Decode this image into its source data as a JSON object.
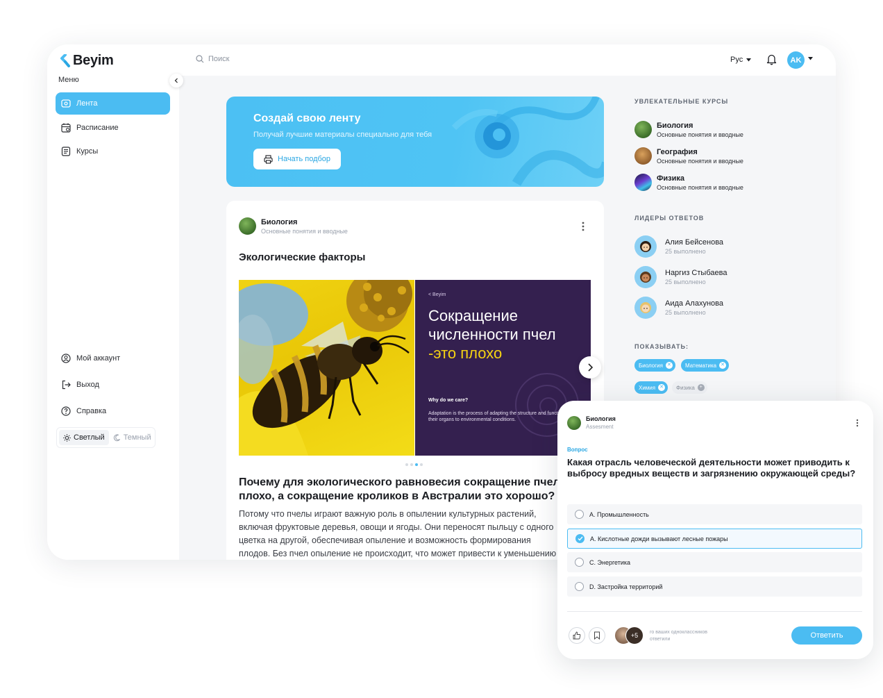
{
  "app": {
    "name": "Beyim"
  },
  "sidebar": {
    "menu_title": "Меню",
    "items": [
      {
        "label": "Лента",
        "icon": "feed-icon",
        "active": true
      },
      {
        "label": "Расписание",
        "icon": "calendar-icon"
      },
      {
        "label": "Курсы",
        "icon": "courses-icon"
      }
    ],
    "bottom_items": [
      {
        "label": "Мой аккаунт",
        "icon": "account-icon"
      },
      {
        "label": "Выход",
        "icon": "logout-icon"
      },
      {
        "label": "Справка",
        "icon": "help-icon"
      }
    ],
    "theme": {
      "light": "Светлый",
      "dark": "Темный",
      "selected": "light"
    }
  },
  "topbar": {
    "search_placeholder": "Поиск",
    "language": "Рус",
    "avatar_initials": "AK"
  },
  "hero": {
    "title": "Создай свою ленту",
    "subtitle": "Получай лучшие материалы специально для тебя",
    "button": "Начать подбор"
  },
  "post": {
    "course": "Биология",
    "course_sub": "Основные понятия и вводные",
    "title": "Экологические факторы",
    "slide": {
      "brand": "Beyim",
      "line1": "Сокращение",
      "line2": "численности пчел",
      "line3": "-это плохо",
      "question": "Why do we care?",
      "text": "Adaptation is the process of adapting the structure and functions of organisms and their organs to environmental conditions."
    },
    "dots_count": 4,
    "dots_active": 2,
    "question": "Почему для экологического равновесия сокращение пчел плохо, а сокращение кроликов в Австралии это хорошо?",
    "answer": "Потому что пчелы играют важную роль в опылении культурных растений, включая фруктовые деревья, овощи и ягоды. Они переносят пыльцу с одного цветка на другой, обеспечивая опыление и возможность формирования плодов.  Без пчел опыление не происходит, что может привести к уменьшению урожая."
  },
  "courses": {
    "heading": "УВЛЕКАТЕЛЬНЫЕ КУРСЫ",
    "items": [
      {
        "title": "Биология",
        "sub": "Основные понятия и вводные"
      },
      {
        "title": "География",
        "sub": "Основные понятия и вводные"
      },
      {
        "title": "Физика",
        "sub": "Основные понятия и вводные"
      }
    ]
  },
  "leaders": {
    "heading": "ЛИДЕРЫ ОТВЕТОВ",
    "items": [
      {
        "name": "Алия Бейсенова",
        "sub": "25 выполнено"
      },
      {
        "name": "Наргиз Стыбаева",
        "sub": "25 выполнено"
      },
      {
        "name": "Аида Алахунова",
        "sub": "25 выполнено"
      }
    ]
  },
  "filters": {
    "heading": "ПОКАЗЫВАТЬ:",
    "chips": [
      {
        "label": "Биология",
        "selected": true
      },
      {
        "label": "Математика",
        "selected": true
      },
      {
        "label": "Химия",
        "selected": true
      },
      {
        "label": "Физика",
        "selected": false
      }
    ]
  },
  "quiz": {
    "course": "Биология",
    "course_sub": "Assesment",
    "label": "Вопрос",
    "question": "Какая отрасль человеческой деятельности может приводить к выбросу вредных веществ и загрязнению окружающей среды?",
    "options": [
      {
        "label": "A. Промышленность",
        "selected": false
      },
      {
        "label": "A. Кислотные дожди вызывают лесные пожары",
        "selected": true
      },
      {
        "label": "C. Энергетика",
        "selected": false
      },
      {
        "label": "D. Застройка территорий",
        "selected": false
      }
    ],
    "more_count": "+5",
    "classmates_line1": "го ваших одноклассников",
    "classmates_line2": "ответили",
    "answer_button": "Ответить"
  },
  "colors": {
    "accent": "#4bbcf2",
    "text": "#1b1d22",
    "muted": "#9aa1ad",
    "slide_dark": "#34204f"
  }
}
